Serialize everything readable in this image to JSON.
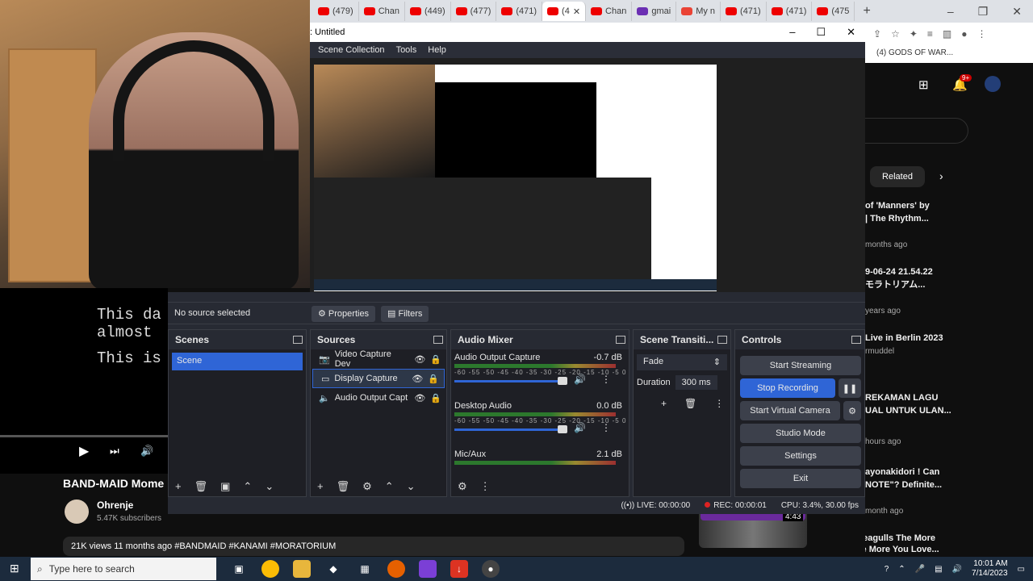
{
  "browser": {
    "tabs": [
      {
        "label": "(479)"
      },
      {
        "label": "Chan"
      },
      {
        "label": "(449)"
      },
      {
        "label": "(477)"
      },
      {
        "label": "(471)"
      },
      {
        "label": "(4"
      },
      {
        "label": "Chan"
      },
      {
        "label": "gmai"
      },
      {
        "label": "My n"
      },
      {
        "label": "(471)"
      },
      {
        "label": "(471)"
      },
      {
        "label": "(475"
      }
    ],
    "new_tab": "+"
  },
  "obs": {
    "window_title": ": Untitled",
    "menu": [
      "Scene Collection",
      "Tools",
      "Help"
    ],
    "toolbar": {
      "no_source": "No source selected",
      "properties": "Properties",
      "filters": "Filters"
    },
    "scenes": {
      "title": "Scenes",
      "items": [
        "Scene"
      ]
    },
    "sources": {
      "title": "Sources",
      "items": [
        "Video Capture Dev",
        "Display Capture",
        "Audio Output Capt"
      ]
    },
    "mixer": {
      "title": "Audio Mixer",
      "tracks": [
        {
          "name": "Audio Output Capture",
          "db": "-0.7 dB"
        },
        {
          "name": "Desktop Audio",
          "db": "0.0 dB"
        },
        {
          "name": "Mic/Aux",
          "db": "2.1 dB"
        }
      ],
      "scale": "-60 -55 -50 -45 -40 -35 -30 -25 -20 -15 -10 -5 0"
    },
    "transitions": {
      "title": "Scene Transiti...",
      "selected": "Fade",
      "duration_label": "Duration",
      "duration": "300 ms"
    },
    "controls": {
      "title": "Controls",
      "start_streaming": "Start Streaming",
      "stop_recording": "Stop Recording",
      "start_virtual_camera": "Start Virtual Camera",
      "studio_mode": "Studio Mode",
      "settings": "Settings",
      "exit": "Exit"
    },
    "status": {
      "live": "LIVE: 00:00:00",
      "rec": "REC: 00:00:01",
      "cpu": "CPU: 3.4%, 30.00 fps"
    }
  },
  "youtube": {
    "lyrics_line1": "This da",
    "lyrics_line2": "almost",
    "lyrics_line3": "This is",
    "video_title": "BAND-MAID Mome",
    "channel": "Ohrenje",
    "subscribers": "5.47K subscribers",
    "meta": "21K views  11 months ago  #BANDMAID #KANAMI #MORATORIUM",
    "right": {
      "top_title": "(4) GODS OF WAR...",
      "related": "Related",
      "items": [
        {
          "title1": "of 'Manners' by",
          "title2": "| The Rhythm...",
          "sub": "months ago"
        },
        {
          "title1": "9-06-24 21.54.22",
          "title2": "モラトリアム...",
          "sub": "years ago"
        },
        {
          "title1": "Live in Berlin 2023",
          "title2": "",
          "sub": "rmuddel"
        },
        {
          "title1": "REKAMAN LAGU",
          "title2": "UAL UNTUK ULAN...",
          "sub": "hours ago"
        },
        {
          "title1": "ayonakidori ! Can",
          "title2": "NOTE\"? Definite...",
          "sub": "month ago"
        },
        {
          "title1": "A Flock of Seagulls The More",
          "title2": "You Live The More You Love...",
          "sub": ""
        }
      ],
      "duration": "4:43",
      "badge": "9+"
    }
  },
  "taskbar": {
    "search_placeholder": "Type here to search",
    "time": "10:01 AM",
    "date": "7/14/2023"
  }
}
